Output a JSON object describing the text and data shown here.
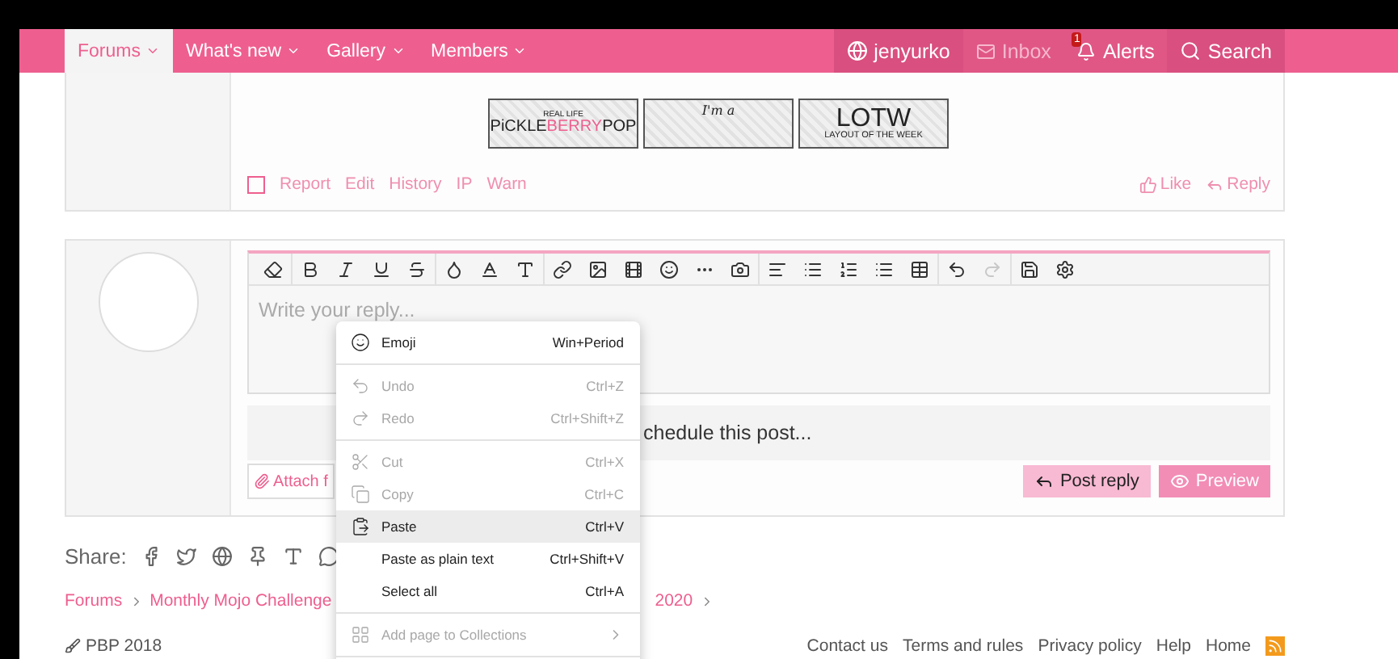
{
  "nav": {
    "tabs": [
      {
        "label": "Forums",
        "selected": true
      },
      {
        "label": "What's new",
        "selected": false
      },
      {
        "label": "Gallery",
        "selected": false
      },
      {
        "label": "Members",
        "selected": false
      }
    ],
    "user": {
      "name": "jenyurko"
    },
    "inbox": {
      "label": "Inbox",
      "disabled": true
    },
    "alerts": {
      "label": "Alerts",
      "badge": "1"
    },
    "search": {
      "label": "Search"
    }
  },
  "post": {
    "banners": [
      {
        "kind": "pbp",
        "top": "REAL LIFE",
        "parts": [
          {
            "text": "PiCKLE",
            "accent": false
          },
          {
            "text": "BERRY",
            "accent": true
          },
          {
            "text": "POP",
            "accent": false
          }
        ]
      },
      {
        "kind": "script",
        "top": "I'm a"
      },
      {
        "kind": "lotw",
        "main": "LOTW",
        "sub": "LAYOUT OF THE WEEK"
      }
    ],
    "selected": false,
    "actions": [
      "Report",
      "Edit",
      "History",
      "IP",
      "Warn"
    ],
    "like": "Like",
    "reply": "Reply"
  },
  "editor": {
    "placeholder": "Write your reply...",
    "redo_disabled": true,
    "schedule": "chedule this post...",
    "attach": "Attach f",
    "post_button": "Post reply",
    "preview_button": "Preview"
  },
  "context_menu": [
    {
      "kind": "item",
      "label": "Emoji",
      "shortcut": "Win+Period",
      "disabled": false,
      "selected": false
    },
    {
      "kind": "divider"
    },
    {
      "kind": "item",
      "label": "Undo",
      "shortcut": "Ctrl+Z",
      "disabled": true,
      "selected": false
    },
    {
      "kind": "item",
      "label": "Redo",
      "shortcut": "Ctrl+Shift+Z",
      "disabled": true,
      "selected": false
    },
    {
      "kind": "divider"
    },
    {
      "kind": "item",
      "label": "Cut",
      "shortcut": "Ctrl+X",
      "disabled": true,
      "selected": false
    },
    {
      "kind": "item",
      "label": "Copy",
      "shortcut": "Ctrl+C",
      "disabled": true,
      "selected": false
    },
    {
      "kind": "item",
      "label": "Paste",
      "shortcut": "Ctrl+V",
      "disabled": false,
      "selected": true
    },
    {
      "kind": "item",
      "label": "Paste as plain text",
      "shortcut": "Ctrl+Shift+V",
      "disabled": false,
      "selected": false
    },
    {
      "kind": "item",
      "label": "Select all",
      "shortcut": "Ctrl+A",
      "disabled": false,
      "selected": false
    },
    {
      "kind": "divider"
    },
    {
      "kind": "submenu",
      "label": "Add page to Collections",
      "disabled": true,
      "selected": false
    },
    {
      "kind": "divider"
    }
  ],
  "share": {
    "label": "Share:"
  },
  "breadcrumb": [
    "Forums",
    "Monthly Mojo Challenge"
  ],
  "breadcrumb_tail": "2020",
  "footer": {
    "copyright": "PBP 2018",
    "links": [
      "Contact us",
      "Terms and rules",
      "Privacy policy",
      "Help",
      "Home"
    ]
  }
}
